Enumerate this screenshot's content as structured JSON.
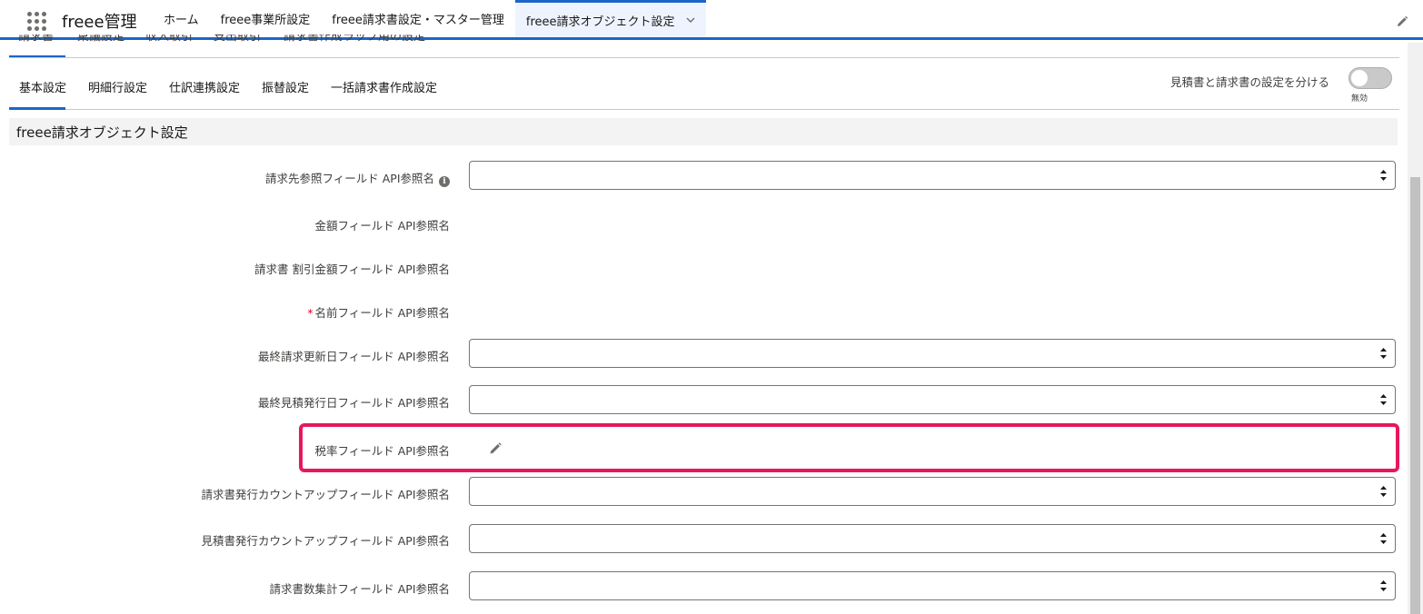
{
  "app": {
    "name": "freee管理"
  },
  "nav": {
    "tabs": [
      {
        "label": "ホーム"
      },
      {
        "label": "freee事業所設定"
      },
      {
        "label": "freee請求書設定・マスター管理"
      },
      {
        "label": "freee請求オブジェクト設定"
      }
    ]
  },
  "upper_tabs": {
    "items": [
      {
        "label": "請求書"
      },
      {
        "label": "稟議設定"
      },
      {
        "label": "収入取引"
      },
      {
        "label": "支出取引"
      },
      {
        "label": "請求書作成ラップ用の設定"
      }
    ]
  },
  "sub_tabs": {
    "items": [
      {
        "label": "基本設定"
      },
      {
        "label": "明細行設定"
      },
      {
        "label": "仕訳連携設定"
      },
      {
        "label": "振替設定"
      },
      {
        "label": "一括請求書作成設定"
      }
    ],
    "toggle_label": "見積書と請求書の設定を分ける",
    "toggle_state": "無効"
  },
  "section": {
    "title": "freee請求オブジェクト設定"
  },
  "form": {
    "rows": [
      {
        "label": "請求先参照フィールド API参照名"
      },
      {
        "label": "金額フィールド API参照名"
      },
      {
        "label": "請求書 割引金額フィールド API参照名"
      },
      {
        "label": "名前フィールド API参照名",
        "required_mark": "*"
      },
      {
        "label": "最終請求更新日フィールド API参照名"
      },
      {
        "label": "最終見積発行日フィールド API参照名"
      },
      {
        "label": "税率フィールド API参照名"
      },
      {
        "label": "請求書発行カウントアップフィールド API参照名"
      },
      {
        "label": "見積書発行カウントアップフィールド API参照名"
      },
      {
        "label": "請求書数集計フィールド API参照名"
      }
    ]
  },
  "colors": {
    "accent": "#1b66c9",
    "highlight": "#e8175d",
    "required": "#ea001e"
  }
}
